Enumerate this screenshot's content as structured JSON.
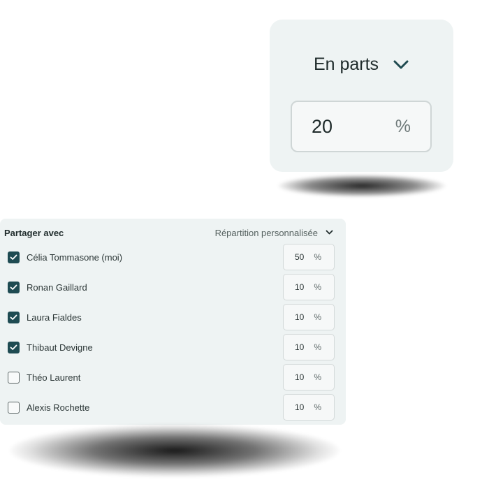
{
  "zoom": {
    "split_label": "En parts",
    "input_value": "20",
    "unit": "%"
  },
  "panel": {
    "title": "Partager avec",
    "split_mode": "Répartition personnalisée",
    "unit": "%",
    "people": [
      {
        "name": "Célia Tommasone (moi)",
        "checked": true,
        "share": "50"
      },
      {
        "name": "Ronan Gaillard",
        "checked": true,
        "share": "10"
      },
      {
        "name": "Laura Fialdes",
        "checked": true,
        "share": "10"
      },
      {
        "name": "Thibaut Devigne",
        "checked": true,
        "share": "10"
      },
      {
        "name": "Théo Laurent",
        "checked": false,
        "share": "10"
      },
      {
        "name": "Alexis Rochette",
        "checked": false,
        "share": "10"
      }
    ]
  },
  "colors": {
    "panel_bg": "#eef3f3",
    "checkbox_checked": "#1e4b52",
    "text": "#2b3636"
  },
  "icons": {
    "dropdown": "chevron-down-icon",
    "checkbox_checked": "checkmark-icon"
  }
}
